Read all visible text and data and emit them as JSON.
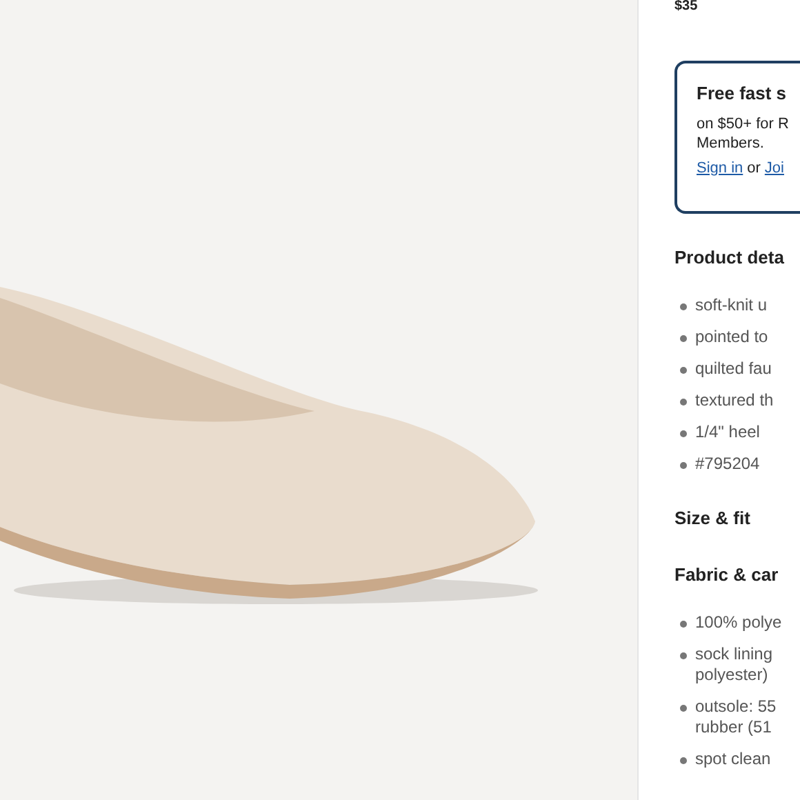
{
  "price": "$35",
  "promo": {
    "title": "Free fast s",
    "body": [
      "on $50+ for R",
      "Members."
    ],
    "sign_in": "Sign in",
    "or": "or",
    "join": "Joi"
  },
  "sections": [
    {
      "title": "Product deta",
      "bullets": [
        {
          "lines": [
            "soft-knit u"
          ]
        },
        {
          "lines": [
            "pointed to"
          ]
        },
        {
          "lines": [
            "quilted fau"
          ]
        },
        {
          "lines": [
            "textured th"
          ]
        },
        {
          "lines": [
            "1/4\" heel"
          ]
        },
        {
          "lines": [
            "#795204"
          ]
        }
      ]
    },
    {
      "title": "Size & fit"
    },
    {
      "title": "Fabric & car",
      "bullets": [
        {
          "lines": [
            "100% polye"
          ]
        },
        {
          "lines": [
            "sock lining",
            "polyester)"
          ]
        },
        {
          "lines": [
            "outsole: 55",
            "rubber (51"
          ]
        },
        {
          "lines": [
            "spot clean"
          ]
        }
      ]
    }
  ]
}
